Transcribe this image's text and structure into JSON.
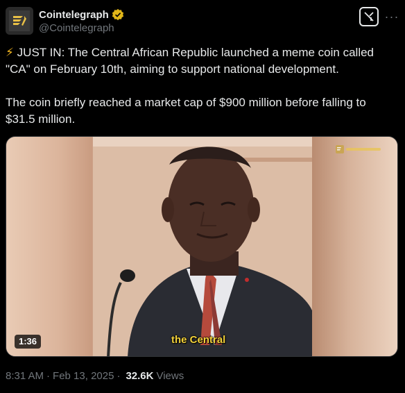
{
  "author": {
    "name": "Cointelegraph",
    "handle": "@Cointelegraph",
    "verified": true,
    "badge_color": "#e2b719"
  },
  "post": {
    "emoji": "⚡",
    "line1": " JUST IN: The Central African Republic launched a meme coin called \"CA\" on February 10th, aiming to support national development.",
    "line2": "The coin briefly reached a market cap of $900 million before falling to $31.5 million."
  },
  "media": {
    "duration": "1:36",
    "caption": "the Central"
  },
  "meta": {
    "time": "8:31 AM",
    "date": "Feb 13, 2025",
    "views_count": "32.6K",
    "views_label": "Views"
  },
  "icons": {
    "grok": "grok-icon",
    "more": "more-icon"
  }
}
